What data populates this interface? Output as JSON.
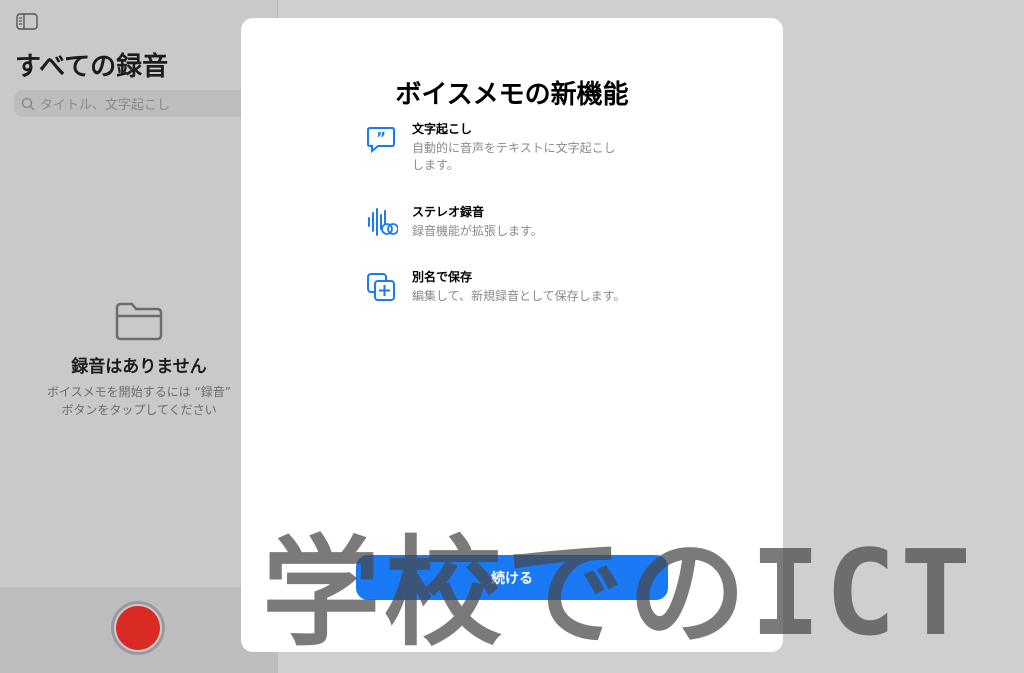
{
  "sidebar": {
    "title": "すべての録音",
    "search_placeholder": "タイトル、文字起こし",
    "empty_title": "録音はありません",
    "empty_line1": "ボイスメモを開始するには “録音”",
    "empty_line2": "ボタンをタップしてください"
  },
  "modal": {
    "title": "ボイスメモの新機能",
    "features": [
      {
        "icon": "quote-bubble-icon",
        "title": "文字起こし",
        "desc": "自動的に音声をテキストに文字起こしします。"
      },
      {
        "icon": "stereo-waveform-icon",
        "title": "ステレオ録音",
        "desc": "録音機能が拡張します。"
      },
      {
        "icon": "duplicate-plus-icon",
        "title": "別名で保存",
        "desc": "編集して、新規録音として保存します。"
      }
    ],
    "continue_label": "続ける"
  },
  "watermark": "学校でのICT",
  "colors": {
    "accent": "#1a7af5",
    "record": "#d92a24"
  }
}
